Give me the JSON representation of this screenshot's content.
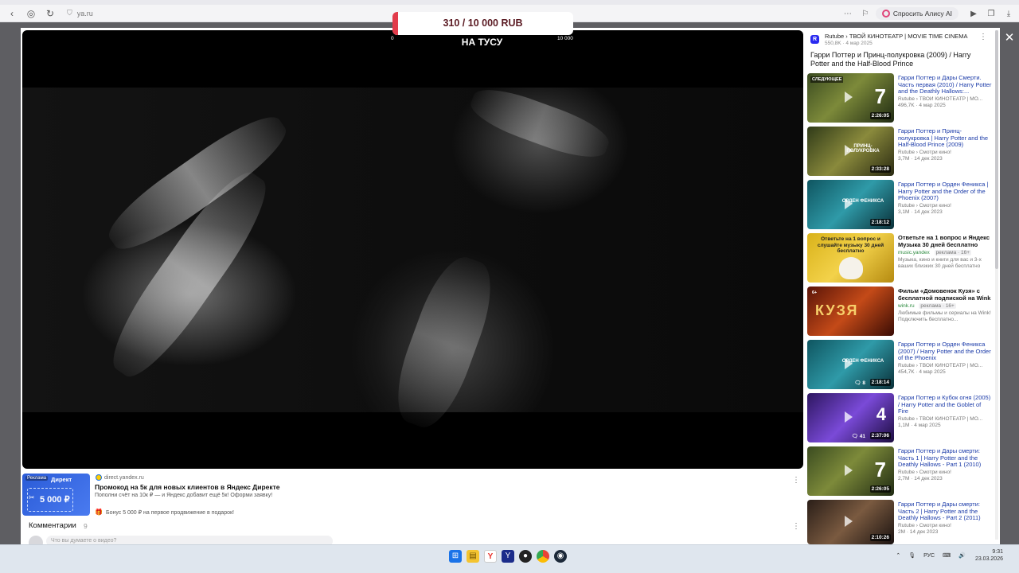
{
  "browser": {
    "url": "ya.ru",
    "alice_button": "Спросить Алису AI"
  },
  "player": {
    "overlay_title": "НА ТУСУ",
    "donation": {
      "text": "310 / 10 000 RUB",
      "scale_min": "0",
      "scale_max": "10 000",
      "progress_fraction": 0.031,
      "fill_color": "#e23b4a"
    }
  },
  "ad": {
    "tag": "Реклама",
    "brand": "Директ",
    "amount": "5 000 ₽",
    "domain": "direct.yandex.ru",
    "title": "Промокод на 5к для новых клиентов в Яндекс Директе",
    "description": "Пополни счёт на 10к ₽ — и Яндекс добавит ещё 5к! Оформи заявку!",
    "bonus": "Бонус 5 000 ₽ на первое продвижение в подарок!"
  },
  "comments": {
    "label": "Комментарии",
    "count": "9",
    "placeholder": "Что вы думаете о видео?"
  },
  "sidebar": {
    "channel_logo": "R",
    "channel": "Rutube › ТВОЙ КИНОТЕАТР | MOVIE TIME CINEMA",
    "channel_meta": "550,8K · 4 мар 2025",
    "title": "Гарри Поттер и Принц-полукровка (2009) / Harry Potter and the Half-Blood Prince",
    "items": [
      {
        "title": "Гарри Поттер и Дары Смерти. Часть первая (2010) / Harry Potter and the Deathly Hallows:...",
        "source": "Rutube › ТВОЙ КИНОТЕАТР | MO...",
        "stats": "496,7K · 4 мар 2025",
        "duration": "2:26:05",
        "badge": "СЛЕДУЮЩЕЕ",
        "caption": "7"
      },
      {
        "title": "Гарри Поттер и Принц-полукровка | Harry Potter and the Half-Blood Prince (2009)",
        "source": "Rutube › Смотри кино!",
        "stats": "3,7M · 14 дек 2023",
        "duration": "2:33:28",
        "caption": "ПРИНЦ-ПОЛУКРОВКА"
      },
      {
        "title": "Гарри Поттер и Орден Феникса | Harry Potter and the Order of the Phoenix (2007)",
        "source": "Rutube › Смотри кино!",
        "stats": "3,1M · 14 дек 2023",
        "duration": "2:18:12",
        "caption": "ОРДЕН ФЕНИКСА"
      },
      {
        "title": "Ответьте на 1 вопрос и Яндекс Музыка 30 дней бесплатно",
        "domain": "music.yandex",
        "ad_tag": "реклама · 16+",
        "desc": "Музыка, кино и книги для вас и 3-х ваших близких 30 дней бесплатно",
        "caption": "Ответьте на 1 вопрос и слушайте музыку 30 дней бесплатно"
      },
      {
        "title": "Фильм «Домовенок Кузя» с бесплатной подпиской на Wink",
        "domain": "wink.ru",
        "ad_tag": "реклама · 16+",
        "desc": "Любимые фильмы и сериалы на Wink! Подключить бесплатно...",
        "caption": "КУЗЯ",
        "badge": "6+"
      },
      {
        "title": "Гарри Поттер и Орден Феникса (2007) / Harry Potter and the Order of the Phoenix",
        "source": "Rutube › ТВОЙ КИНОТЕАТР | MO...",
        "stats": "454,7K · 4 мар 2025",
        "duration": "2:18:14",
        "comments": "8",
        "caption": "ОРДЕН ФЕНИКСА"
      },
      {
        "title": "Гарри Поттер и Кубок огня (2005) / Harry Potter and the Goblet of Fire",
        "source": "Rutube › ТВОЙ КИНОТЕАТР | MO...",
        "stats": "1,1M · 4 мар 2025",
        "duration": "2:37:06",
        "comments": "41",
        "caption": "4"
      },
      {
        "title": "Гарри Поттер и Дары смерти: Часть 1 | Harry Potter and the Deathly Hallows - Part 1 (2010)",
        "source": "Rutube › Смотри кино!",
        "stats": "2,7M · 14 дек 2023",
        "duration": "2:26:05",
        "caption": "7"
      },
      {
        "title": "Гарри Поттер и Дары смерти: Часть 2 | Harry Potter and the Deathly Hallows - Part 2 (2011)",
        "source": "Rutube › Смотри кино!",
        "stats": "2M · 14 дек 2023",
        "duration": "2:10:26"
      }
    ]
  },
  "taskbar": {
    "lang": "РУС",
    "time": "9:31",
    "date": "23.03.2026"
  }
}
